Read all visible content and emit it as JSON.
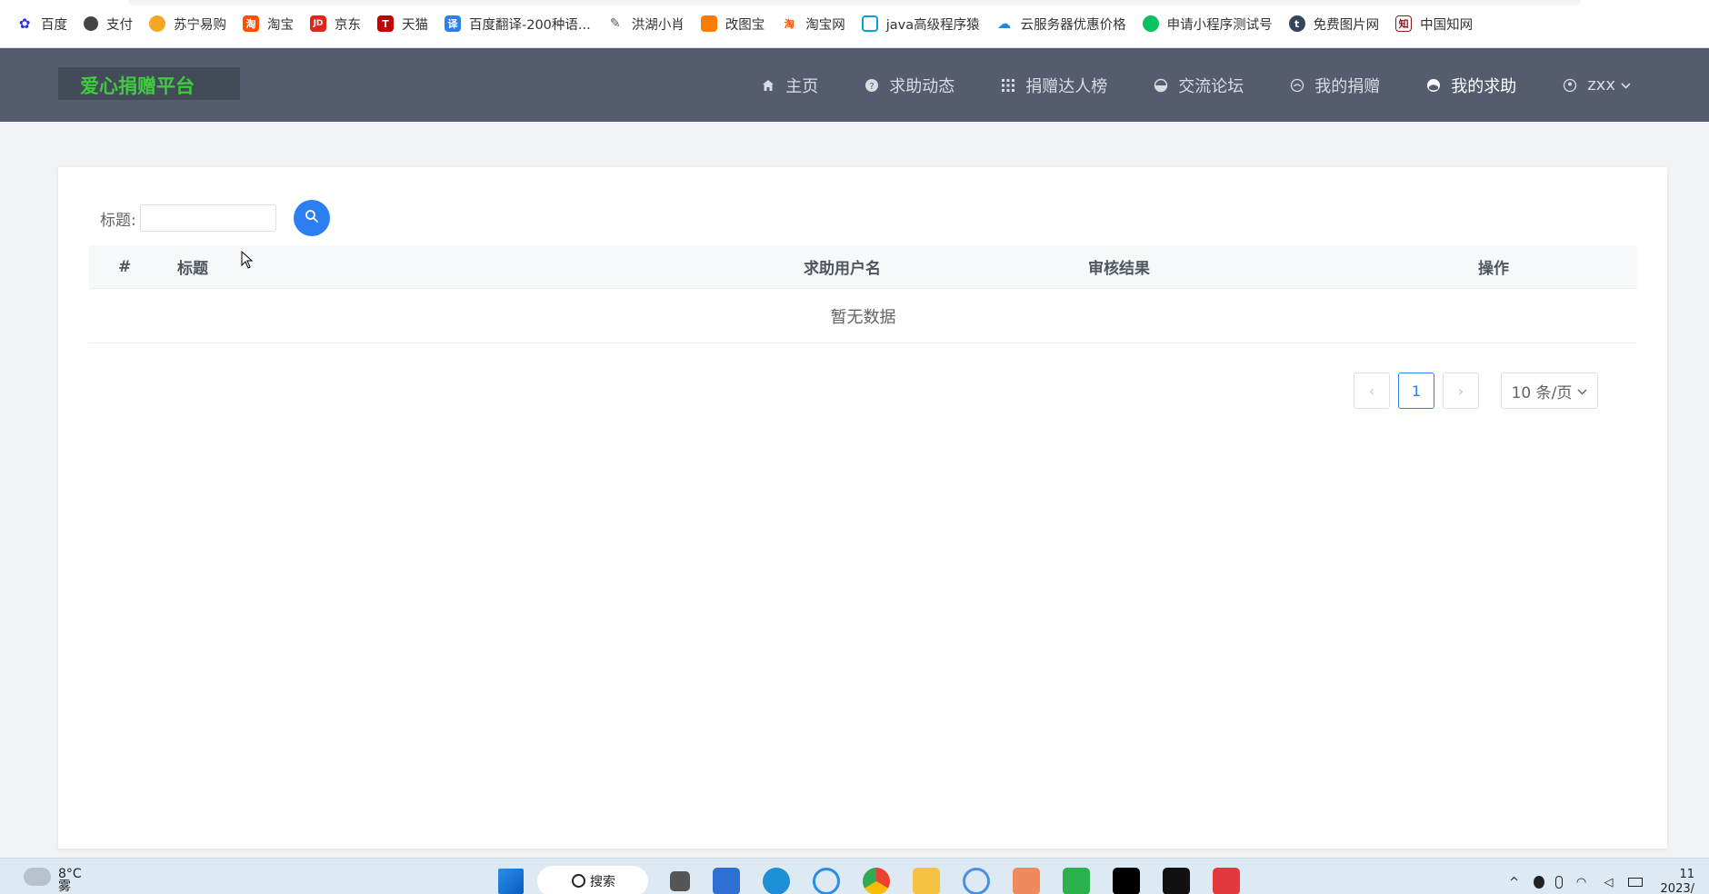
{
  "bookmarks": [
    {
      "label": "百度",
      "icon": "baidu-paw-icon",
      "color": "#2932e1"
    },
    {
      "label": "支付",
      "icon": "globe-icon",
      "color": "#444444"
    },
    {
      "label": "苏宁易购",
      "icon": "suning-icon",
      "color": "#f5a623"
    },
    {
      "label": "淘宝",
      "icon": "taobao-icon",
      "color": "#ff5000"
    },
    {
      "label": "京东",
      "icon": "jd-icon",
      "color": "#e1251b"
    },
    {
      "label": "天猫",
      "icon": "tmall-icon",
      "color": "#c40000"
    },
    {
      "label": "百度翻译-200种语...",
      "icon": "translate-icon",
      "color": "#2b7ff0"
    },
    {
      "label": "洪湖小肖",
      "icon": "bird-icon",
      "color": "#555555"
    },
    {
      "label": "改图宝",
      "icon": "image-edit-icon",
      "color": "#ff7a00"
    },
    {
      "label": "淘宝网",
      "icon": "taobao-icon",
      "color": "#ff5000"
    },
    {
      "label": "java高级程序猿",
      "icon": "bilibili-icon",
      "color": "#00a1d6"
    },
    {
      "label": "云服务器优惠价格",
      "icon": "cloud-icon",
      "color": "#1e88e5"
    },
    {
      "label": "申请小程序测试号",
      "icon": "wechat-icon",
      "color": "#07c160"
    },
    {
      "label": "免费图片网",
      "icon": "tumblr-icon",
      "color": "#35465c"
    },
    {
      "label": "中国知网",
      "icon": "cnki-icon",
      "color": "#8b1a1a"
    }
  ],
  "app": {
    "logo": "爱心捐赠平台",
    "menu": [
      {
        "label": "主页",
        "icon": "home-icon"
      },
      {
        "label": "求助动态",
        "icon": "help-circle-icon"
      },
      {
        "label": "捐赠达人榜",
        "icon": "grid-icon"
      },
      {
        "label": "交流论坛",
        "icon": "chat-icon"
      },
      {
        "label": "我的捐赠",
        "icon": "gift-icon"
      },
      {
        "label": "我的求助",
        "icon": "help-icon",
        "active": true
      },
      {
        "label": "zxx",
        "icon": "user-icon"
      }
    ]
  },
  "search": {
    "label": "标题:",
    "value": "",
    "placeholder": ""
  },
  "table": {
    "columns": [
      "#",
      "标题",
      "求助用户名",
      "审核结果",
      "操作"
    ],
    "rows": [],
    "empty_text": "暂无数据"
  },
  "pagination": {
    "prev": "‹",
    "current": "1",
    "next": "›",
    "page_size": "10 条/页"
  },
  "taskbar": {
    "temperature": "8°C",
    "weather": "雾",
    "search_label": "搜索",
    "clock_time": "11",
    "clock_date": "2023/"
  },
  "colors": {
    "nav_bg": "#545c6d",
    "logo_text": "#3ecb3e",
    "primary": "#2b7ff0"
  }
}
